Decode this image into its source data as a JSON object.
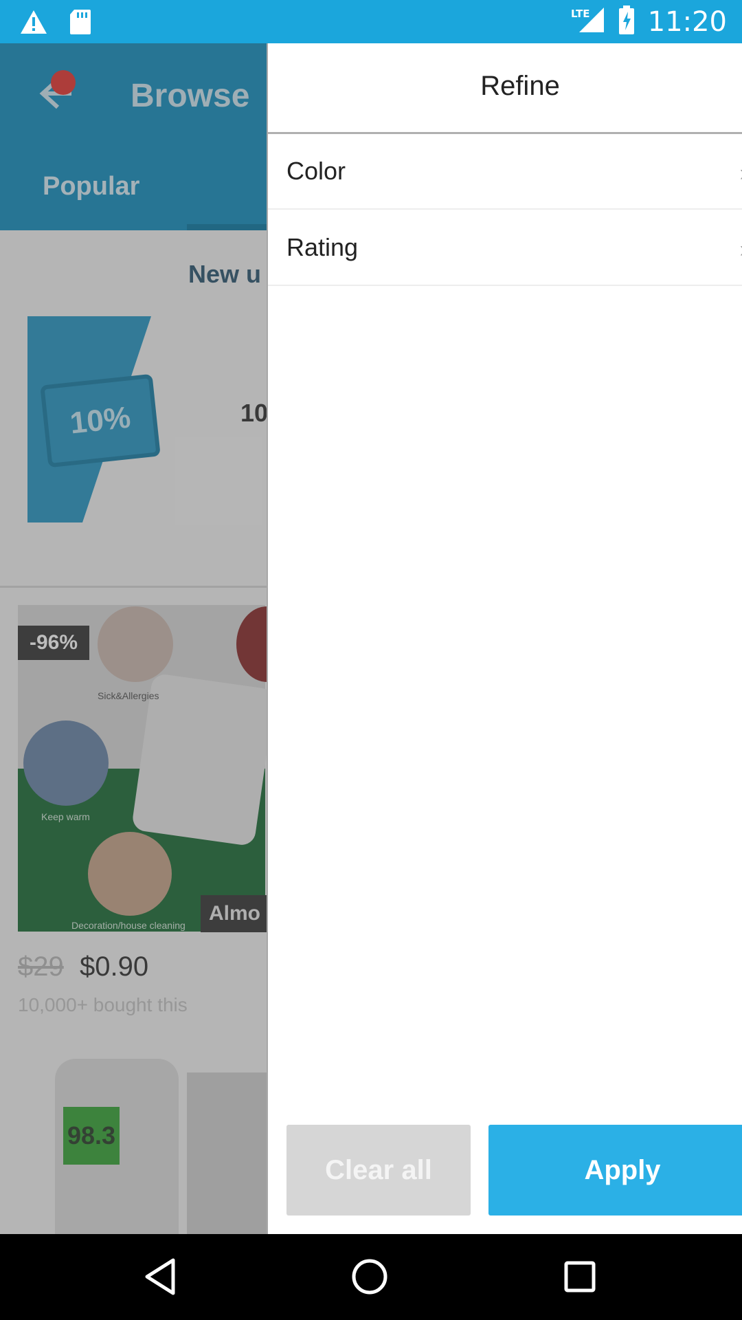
{
  "status_bar": {
    "network": "LTE",
    "time": "11:20",
    "icons": [
      "warning-icon",
      "sd-card-icon",
      "signal-icon",
      "battery-charging-icon"
    ]
  },
  "background_app": {
    "title": "Browse",
    "tabs": [
      "Popular"
    ],
    "new_user_banner": "New u",
    "coupon_percent": "10%",
    "coupon_side_text": "10",
    "product": {
      "discount": "-96%",
      "captions": [
        "Sick&Allergies",
        "Keep warm",
        "Decoration/house cleaning"
      ],
      "tag": "Almo",
      "price_old": "$29",
      "price_new": "$0.90",
      "bought": "10,000+ bought this"
    },
    "thermometer_reading": "98.3"
  },
  "drawer": {
    "title": "Refine",
    "filters": [
      {
        "label": "Color"
      },
      {
        "label": "Rating"
      }
    ],
    "clear_label": "Clear all",
    "apply_label": "Apply"
  },
  "colors": {
    "status_bar": "#1ba6dc",
    "apply": "#2bb0e6",
    "clear": "#d6d6d6"
  }
}
